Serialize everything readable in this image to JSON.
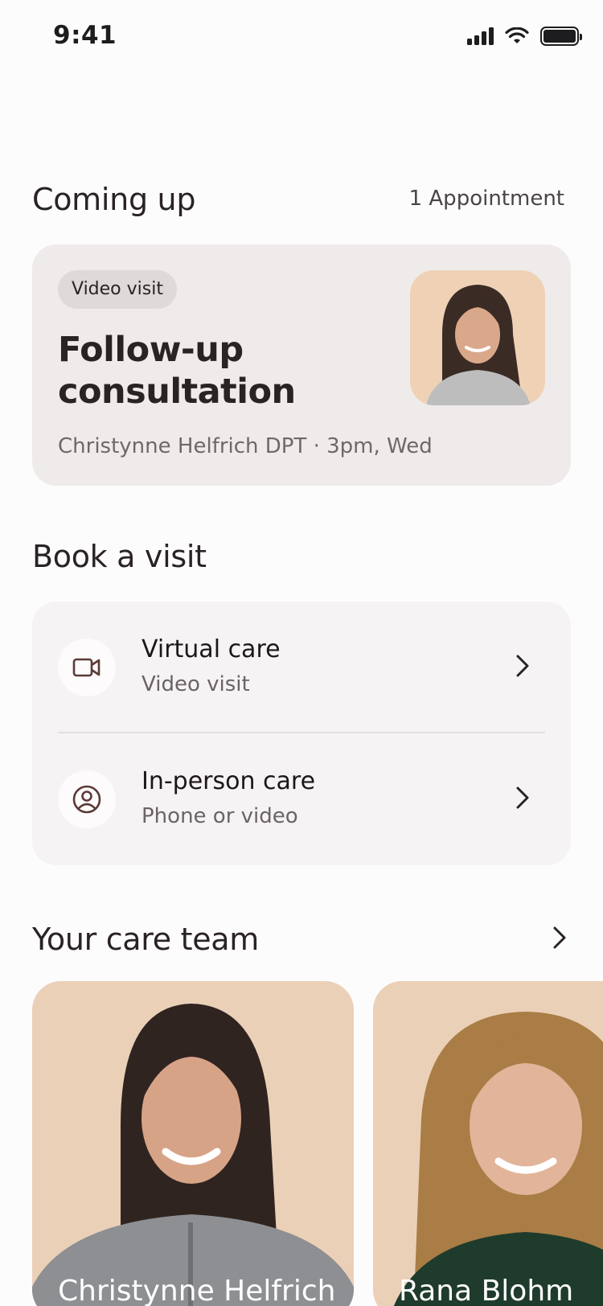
{
  "status_bar": {
    "time": "9:41"
  },
  "coming_up": {
    "title": "Coming up",
    "count": "1 Appointment",
    "appointment": {
      "badge": "Video visit",
      "title": "Follow-up consultation",
      "meta": "Christynne Helfrich DPT · 3pm, Wed",
      "photo_icon": "provider-avatar"
    }
  },
  "book_visit": {
    "title": "Book a visit",
    "options": [
      {
        "title": "Virtual care",
        "subtitle": "Video visit",
        "icon": "video-camera-icon"
      },
      {
        "title": "In-person care",
        "subtitle": "Phone or video",
        "icon": "user-circle-icon"
      }
    ]
  },
  "care_team": {
    "title": "Your care team",
    "members": [
      {
        "name": "Christynne Helfrich"
      },
      {
        "name": "Rana Blohm"
      }
    ]
  },
  "colors": {
    "background": "#fdfcfd",
    "appointment_card": "#efebeb",
    "book_card": "#f6f3f4",
    "text_primary": "#2a2323",
    "text_secondary": "#6f6868",
    "icon_accent": "#5a3a38"
  }
}
